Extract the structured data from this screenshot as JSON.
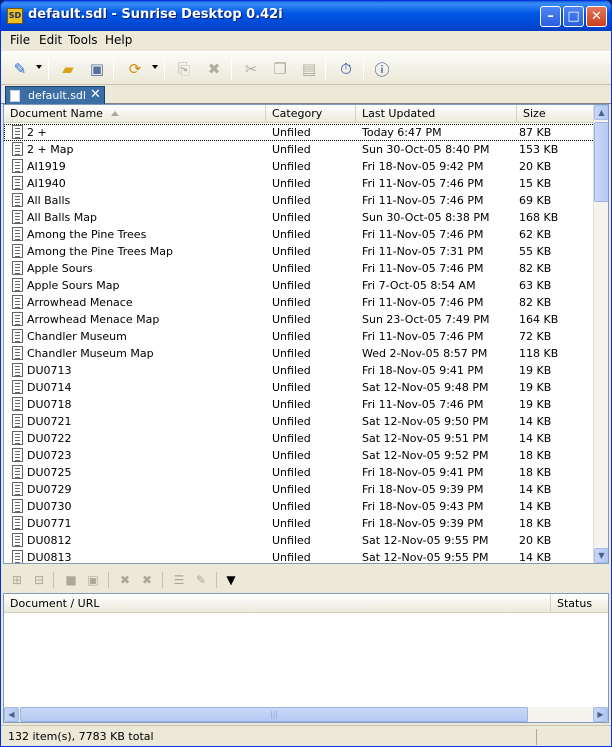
{
  "window": {
    "title": "default.sdl - Sunrise Desktop 0.42i",
    "app_icon_text": "SD"
  },
  "menu": [
    "File",
    "Edit",
    "Tools",
    "Help"
  ],
  "toolbar_icons": [
    "new-document-icon",
    "open-folder-icon",
    "save-icon",
    "sync-icon",
    "copy-page-icon",
    "delete-icon",
    "cut-icon",
    "copy-icon",
    "paste-icon",
    "stopwatch-icon",
    "help-icon"
  ],
  "tab": {
    "label": "default.sdl",
    "close": "✕"
  },
  "columns": {
    "name": "Document Name",
    "category": "Category",
    "updated": "Last Updated",
    "size": "Size"
  },
  "rows": [
    {
      "name": "2 +",
      "category": "Unfiled",
      "updated": "Today 6:47 PM",
      "size": "87 KB"
    },
    {
      "name": "2 + Map",
      "category": "Unfiled",
      "updated": "Sun 30-Oct-05 8:40 PM",
      "size": "153 KB"
    },
    {
      "name": "AI1919",
      "category": "Unfiled",
      "updated": "Fri 18-Nov-05 9:42 PM",
      "size": "20 KB"
    },
    {
      "name": "AI1940",
      "category": "Unfiled",
      "updated": "Fri 11-Nov-05 7:46 PM",
      "size": "15 KB"
    },
    {
      "name": "All Balls",
      "category": "Unfiled",
      "updated": "Fri 11-Nov-05 7:46 PM",
      "size": "69 KB"
    },
    {
      "name": "All Balls Map",
      "category": "Unfiled",
      "updated": "Sun 30-Oct-05 8:38 PM",
      "size": "168 KB"
    },
    {
      "name": "Among the Pine Trees",
      "category": "Unfiled",
      "updated": "Fri 11-Nov-05 7:46 PM",
      "size": "62 KB"
    },
    {
      "name": "Among the Pine Trees Map",
      "category": "Unfiled",
      "updated": "Fri 11-Nov-05 7:31 PM",
      "size": "55 KB"
    },
    {
      "name": "Apple Sours",
      "category": "Unfiled",
      "updated": "Fri 11-Nov-05 7:46 PM",
      "size": "82 KB"
    },
    {
      "name": "Apple Sours Map",
      "category": "Unfiled",
      "updated": "Fri 7-Oct-05 8:54 AM",
      "size": "63 KB"
    },
    {
      "name": "Arrowhead Menace",
      "category": "Unfiled",
      "updated": "Fri 11-Nov-05 7:46 PM",
      "size": "82 KB"
    },
    {
      "name": "Arrowhead Menace Map",
      "category": "Unfiled",
      "updated": "Sun 23-Oct-05 7:49 PM",
      "size": "164 KB"
    },
    {
      "name": "Chandler Museum",
      "category": "Unfiled",
      "updated": "Fri 11-Nov-05 7:46 PM",
      "size": "72 KB"
    },
    {
      "name": "Chandler Museum Map",
      "category": "Unfiled",
      "updated": "Wed 2-Nov-05 8:57 PM",
      "size": "118 KB"
    },
    {
      "name": "DU0713",
      "category": "Unfiled",
      "updated": "Fri 18-Nov-05 9:41 PM",
      "size": "19 KB"
    },
    {
      "name": "DU0714",
      "category": "Unfiled",
      "updated": "Sat 12-Nov-05 9:48 PM",
      "size": "19 KB"
    },
    {
      "name": "DU0718",
      "category": "Unfiled",
      "updated": "Fri 11-Nov-05 7:46 PM",
      "size": "19 KB"
    },
    {
      "name": "DU0721",
      "category": "Unfiled",
      "updated": "Sat 12-Nov-05 9:50 PM",
      "size": "14 KB"
    },
    {
      "name": "DU0722",
      "category": "Unfiled",
      "updated": "Sat 12-Nov-05 9:51 PM",
      "size": "14 KB"
    },
    {
      "name": "DU0723",
      "category": "Unfiled",
      "updated": "Sat 12-Nov-05 9:52 PM",
      "size": "18 KB"
    },
    {
      "name": "DU0725",
      "category": "Unfiled",
      "updated": "Fri 18-Nov-05 9:41 PM",
      "size": "18 KB"
    },
    {
      "name": "DU0729",
      "category": "Unfiled",
      "updated": "Fri 18-Nov-05 9:39 PM",
      "size": "14 KB"
    },
    {
      "name": "DU0730",
      "category": "Unfiled",
      "updated": "Fri 18-Nov-05 9:43 PM",
      "size": "14 KB"
    },
    {
      "name": "DU0771",
      "category": "Unfiled",
      "updated": "Fri 18-Nov-05 9:39 PM",
      "size": "18 KB"
    },
    {
      "name": "DU0812",
      "category": "Unfiled",
      "updated": "Sat 12-Nov-05 9:55 PM",
      "size": "20 KB"
    },
    {
      "name": "DU0813",
      "category": "Unfiled",
      "updated": "Sat 12-Nov-05 9:55 PM",
      "size": "14 KB"
    }
  ],
  "lower_pane": {
    "col_document": "Document / URL",
    "col_status": "Status"
  },
  "status": {
    "text": "132 item(s), 7783 KB total"
  },
  "colors": {
    "titlebar": "#0058e6",
    "tab": "#3a6ea5",
    "chrome": "#ece9d8"
  }
}
